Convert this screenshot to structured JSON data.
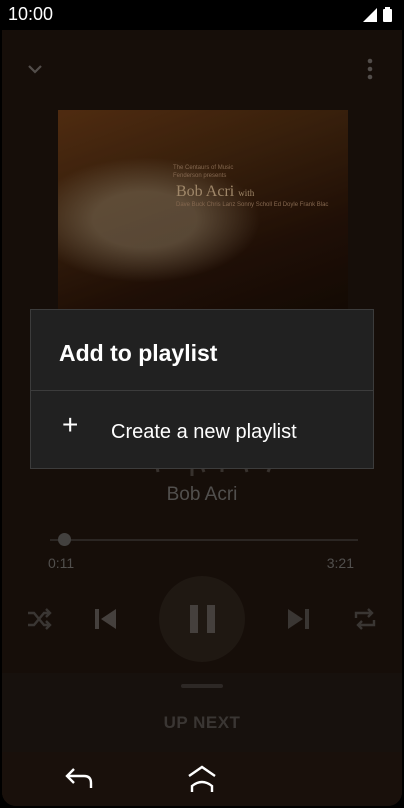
{
  "status": {
    "time": "10:00"
  },
  "album": {
    "line1": "The Centaurs of Music Fenderson presents",
    "name": "Bob Acri",
    "name_suffix": "with",
    "sub": "Dave Buck  Chris Lanz  Sonny Scholl  Ed Doyle  Frank Blac"
  },
  "track": {
    "artist": "Bob Acri"
  },
  "progress": {
    "elapsed": "0:11",
    "total": "3:21",
    "fraction": 0.055
  },
  "up_next": "UP NEXT",
  "dialog": {
    "title": "Add to playlist",
    "create_label": "Create a new playlist"
  }
}
